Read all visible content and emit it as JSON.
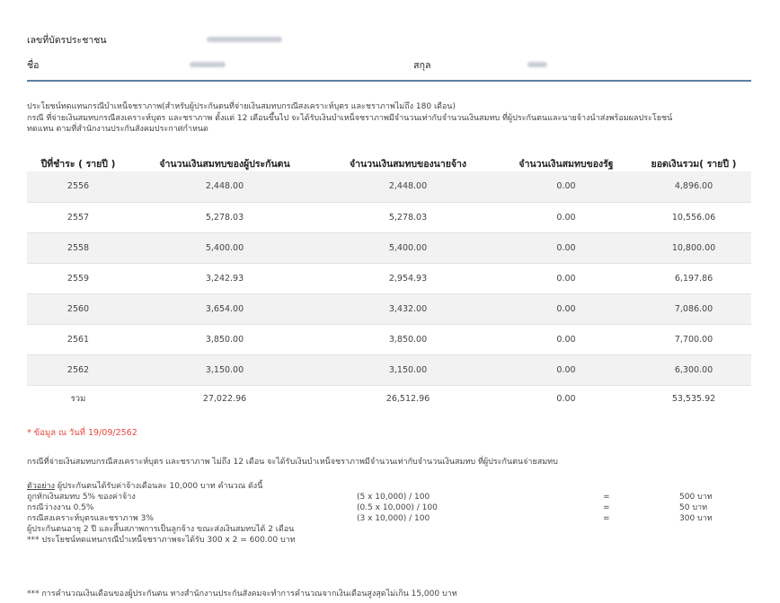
{
  "personal": {
    "id_label": "เลขที่บัตรประชาชน",
    "name_label": "ชื่อ",
    "surname_label": "สกุล"
  },
  "description": {
    "line1": "ประโยชน์ทดแทนกรณีบำเหน็จชราภาพ(สำหรับผู้ประกันตนที่จ่ายเงินสมทบกรณีสงเคราะห์บุตร และชราภาพไม่ถึง 180 เดือน)",
    "line2": "กรณี ที่จ่ายเงินสมทบกรณีสงเคราะห์บุตร และชราภาพ ตั้งแต่ 12 เดือนขึ้นไป จะได้รับเงินบำเหน็จชราภาพมีจำนวนเท่ากับจำนวนเงินสมทบ ที่ผู้ประกันตนและนายจ้างนำส่งพร้อมผลประโยชน์",
    "line3": "ทดแทน ตามที่สำนักงานประกันสังคมประกาศกำหนด"
  },
  "table": {
    "headers": [
      "ปีที่ชำระ ( รายปี )",
      "จำนวนเงินสมทบของผู้ประกันตน",
      "จำนวนเงินสมทบของนายจ้าง",
      "จำนวนเงินสมทบของรัฐ",
      "ยอดเงินรวม( รายปี )"
    ],
    "rows": [
      [
        "2556",
        "2,448.00",
        "2,448.00",
        "0.00",
        "4,896.00"
      ],
      [
        "2557",
        "5,278.03",
        "5,278.03",
        "0.00",
        "10,556.06"
      ],
      [
        "2558",
        "5,400.00",
        "5,400.00",
        "0.00",
        "10,800.00"
      ],
      [
        "2559",
        "3,242.93",
        "2,954.93",
        "0.00",
        "6,197.86"
      ],
      [
        "2560",
        "3,654.00",
        "3,432.00",
        "0.00",
        "7,086.00"
      ],
      [
        "2561",
        "3,850.00",
        "3,850.00",
        "0.00",
        "7,700.00"
      ],
      [
        "2562",
        "3,150.00",
        "3,150.00",
        "0.00",
        "6,300.00"
      ]
    ],
    "total": [
      "รวม",
      "27,022.96",
      "26,512.96",
      "0.00",
      "53,535.92"
    ]
  },
  "data_note": "* ข้อมูล ณ วันที่   19/09/2562",
  "condition_note": "กรณีที่จ่ายเงินสมทบกรณีสงเคราะห์บุตร และชราภาพ ไม่ถึง 12 เดือน จะได้รับเงินบำเหน็จชราภาพมีจำนวนเท่ากับจำนวนเงินสมทบ ที่ผู้ประกันตนจ่ายสมทบ",
  "example": {
    "title_underlined": "ตัวอย่าง",
    "title_rest": "  ผู้ประกันตนได้รับค่าจ้างเดือนละ 10,000 บาท คำนวณ ดังนี้",
    "rows": [
      {
        "label": "ถูกหักเงินสมทบ 5% ของค่าจ้าง",
        "formula": "(5 x 10,000) / 100",
        "eq": "=",
        "result": "500 บาท"
      },
      {
        "label": "กรณีว่างงาน 0.5%",
        "formula": "(0.5 x 10,000) / 100",
        "eq": "=",
        "result": "50 บาท"
      },
      {
        "label": "กรณีสงเคราะห์บุตรและชราภาพ 3%",
        "formula": "(3 x 10,000) / 100",
        "eq": "=",
        "result": "300 บาท"
      }
    ],
    "line_after": "ผู้ประกันตนอายุ 2 ปี และสิ้นสภาพการเป็นลูกจ้าง ขณะส่งเงินสมทบได้ 2 เดือน",
    "result_line": "*** ประโยชน์ทดแทนกรณีบำเหน็จชราภาพจะได้รับ 300 x 2 = 600.00 บาท"
  },
  "footer_note": "*** การคำนวณเงินเดือนของผู้ประกันตน ทางสำนักงานประกันสังคมจะทำการคำนวณจากเงินเดือนสูงสุดไม่เกิน 15,000 บาท"
}
